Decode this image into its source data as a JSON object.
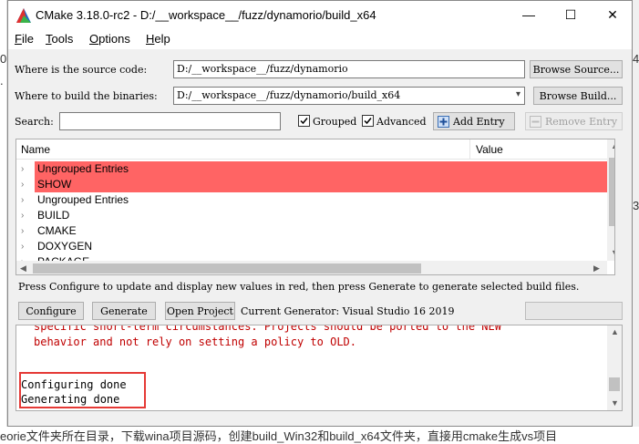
{
  "background": {
    "left_chars": [
      "0.",
      "."
    ],
    "right_chars": [
      "4",
      "3"
    ],
    "bottom_text": "eorie文件夹所在目录，下载wina项目源码，创建build_Win32和build_x64文件夹，直接用cmake生成vs项目"
  },
  "window": {
    "title": "CMake 3.18.0-rc2 - D:/__workspace__/fuzz/dynamorio/build_x64",
    "controls": {
      "minimize": "—",
      "maximize": "☐",
      "close": "✕"
    }
  },
  "menu": [
    {
      "accel": "F",
      "rest": "ile"
    },
    {
      "accel": "T",
      "rest": "ools"
    },
    {
      "accel": "O",
      "rest": "ptions"
    },
    {
      "accel": "H",
      "rest": "elp"
    }
  ],
  "source": {
    "label": "Where is the source code:",
    "value": "D:/__workspace__/fuzz/dynamorio",
    "browse_label": "Browse Source..."
  },
  "build": {
    "label": "Where to build the binaries:",
    "value": "D:/__workspace__/fuzz/dynamorio/build_x64",
    "browse_label": "Browse Build..."
  },
  "search": {
    "label": "Search:",
    "value": ""
  },
  "options": {
    "grouped": {
      "label": "Grouped",
      "checked": true
    },
    "advanced": {
      "label": "Advanced",
      "checked": true
    },
    "add_entry_label": "Add Entry",
    "remove_entry_label": "Remove Entry"
  },
  "tree": {
    "columns": [
      "Name",
      "Value"
    ],
    "rows": [
      {
        "label": "Ungrouped Entries",
        "highlight": true
      },
      {
        "label": "SHOW",
        "highlight": true
      },
      {
        "label": "Ungrouped Entries",
        "highlight": false
      },
      {
        "label": "BUILD",
        "highlight": false
      },
      {
        "label": "CMAKE",
        "highlight": false
      },
      {
        "label": "DOXYGEN",
        "highlight": false
      },
      {
        "label": "PACKAGE",
        "highlight": false
      }
    ]
  },
  "hint": "Press Configure to update and display new values in red, then press Generate to generate selected build files.",
  "actions": {
    "configure_label": "Configure",
    "generate_label": "Generate",
    "open_project_label": "Open Project",
    "current_generator": "Current Generator: Visual Studio 16 2019"
  },
  "output": {
    "lines_red": [
      "specific short-term circumstances.  Projects should be ported to the NEW",
      "behavior and not rely on setting a policy to OLD."
    ],
    "lines_done": [
      "Configuring done",
      "Generating done"
    ]
  },
  "colors": {
    "highlight": "#ff6464",
    "error_text": "#c00000",
    "annotation_box": "#e53935"
  }
}
